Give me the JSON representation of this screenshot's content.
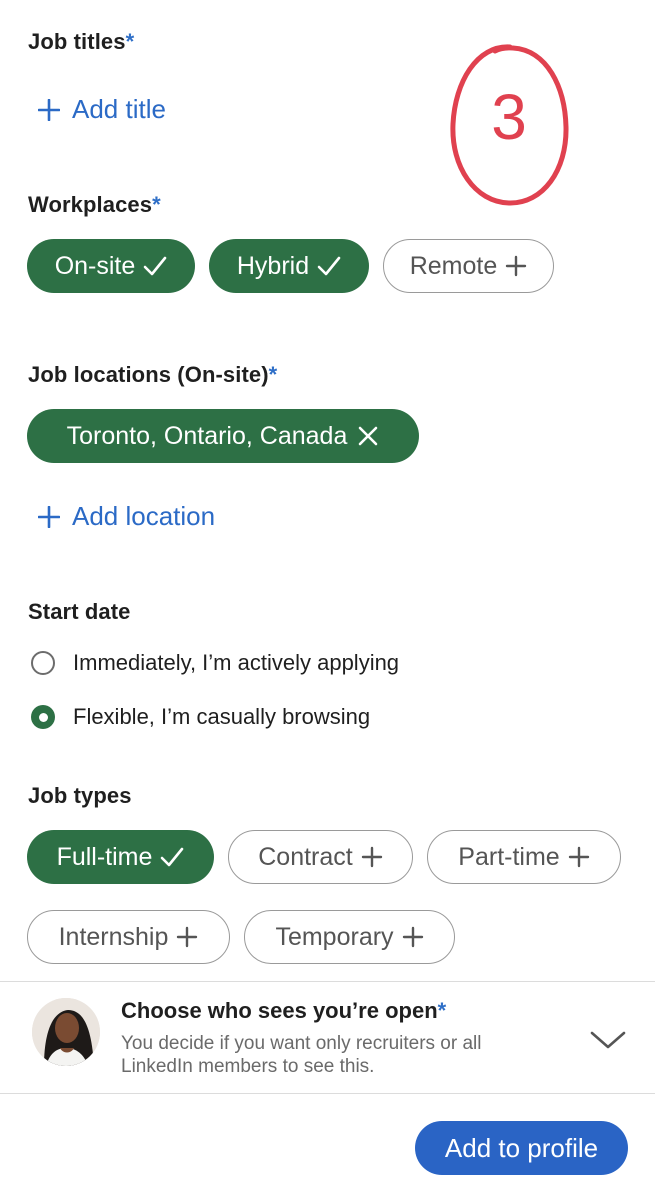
{
  "job_titles": {
    "label": "Job titles",
    "required_mark": "*",
    "add_label": "Add title"
  },
  "annotation": {
    "text": "3",
    "color": "#e0414f"
  },
  "workplaces": {
    "label": "Workplaces",
    "required_mark": "*",
    "options": [
      {
        "label": "On-site",
        "selected": true
      },
      {
        "label": "Hybrid",
        "selected": true
      },
      {
        "label": "Remote",
        "selected": false
      }
    ]
  },
  "job_locations": {
    "label": "Job locations (On-site)",
    "required_mark": "*",
    "chips": [
      {
        "label": "Toronto, Ontario, Canada"
      }
    ],
    "add_label": "Add location"
  },
  "start_date": {
    "label": "Start date",
    "options": [
      {
        "label": "Immediately, I’m actively applying",
        "checked": false
      },
      {
        "label": "Flexible, I’m casually browsing",
        "checked": true
      }
    ]
  },
  "job_types": {
    "label": "Job types",
    "options": [
      {
        "label": "Full-time",
        "selected": true
      },
      {
        "label": "Contract",
        "selected": false
      },
      {
        "label": "Part-time",
        "selected": false
      },
      {
        "label": "Internship",
        "selected": false
      },
      {
        "label": "Temporary",
        "selected": false
      }
    ]
  },
  "visibility": {
    "title": "Choose who sees you’re open",
    "required_mark": "*",
    "description": "You decide if you want only recruiters or all LinkedIn members to see this."
  },
  "footer": {
    "primary_label": "Add to profile"
  },
  "colors": {
    "selected_chip": "#2d7045",
    "link_blue": "#2b6ac6",
    "primary_button": "#2a64c5",
    "chip_border": "#9a9a9a"
  }
}
